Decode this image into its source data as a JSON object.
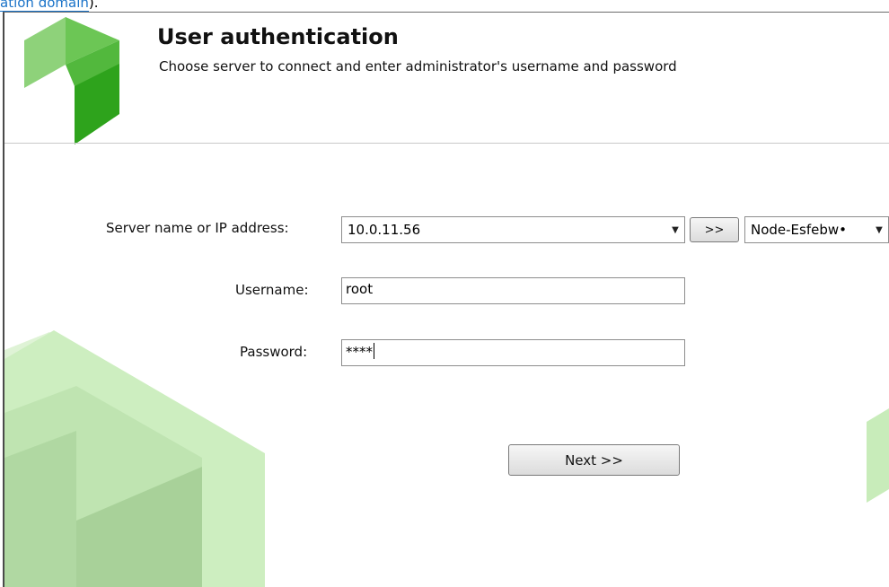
{
  "top_link": {
    "text": "ation domain",
    "suffix": ")."
  },
  "header": {
    "title": "User authentication",
    "subtitle": "Choose server to connect and enter administrator's username and password"
  },
  "form": {
    "server_label": "Server name or IP address:",
    "server_value": "10.0.11.56",
    "browse_button": ">>",
    "node_value": "Node-Esfebw•",
    "username_label": "Username:",
    "username_value": "root",
    "password_label": "Password:",
    "password_value": "****"
  },
  "actions": {
    "next_label": "Next >>"
  },
  "colors": {
    "brand_green_dark": "#2ea31c",
    "brand_green_mid": "#6cc655",
    "brand_green_light": "#a9dc96",
    "bg_green": "#d6f0cc"
  }
}
